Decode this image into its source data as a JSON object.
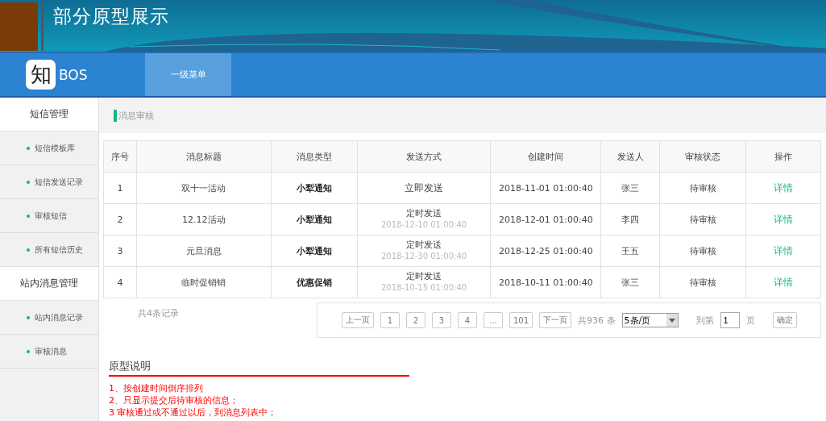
{
  "banner": {
    "title": "部分原型展示"
  },
  "nav": {
    "logo_mark": "知",
    "logo_text": "BOS",
    "menu": [
      {
        "label": "一级菜单",
        "selected": true
      }
    ]
  },
  "sidebar": {
    "groups": [
      {
        "title": "短信管理",
        "items": [
          {
            "label": "短信模板库"
          },
          {
            "label": "短信发送记录"
          },
          {
            "label": "审核短信"
          },
          {
            "label": "所有短信历史"
          }
        ]
      },
      {
        "title": "站内消息管理",
        "items": [
          {
            "label": "站内消息记录"
          },
          {
            "label": "审核消息"
          }
        ]
      }
    ]
  },
  "breadcrumb": "消息审核",
  "table": {
    "columns": [
      "序号",
      "消息标题",
      "消息类型",
      "发送方式",
      "创建时间",
      "发送人",
      "审核状态",
      "操作"
    ],
    "rows": [
      {
        "no": "1",
        "title": "双十一活动",
        "type": "小犁通知",
        "send": {
          "kind": "immediate",
          "method": "立即发送"
        },
        "created": "2018-11-01  01:00:40",
        "sender": "张三",
        "status": "待审核",
        "action": "详情"
      },
      {
        "no": "2",
        "title": "12.12活动",
        "type": "小犁通知",
        "send": {
          "kind": "scheduled",
          "method": "定时发送",
          "time": "2018-12-10  01:00:40"
        },
        "created": "2018-12-01  01:00:40",
        "sender": "李四",
        "status": "待审核",
        "action": "详情"
      },
      {
        "no": "3",
        "title": "元旦消息",
        "type": "小犁通知",
        "send": {
          "kind": "scheduled",
          "method": "定时发送",
          "time": "2018-12-30  01:00:40"
        },
        "created": "2018-12-25  01:00:40",
        "sender": "王五",
        "status": "待审核",
        "action": "详情"
      },
      {
        "no": "4",
        "title": "临时促销销",
        "type": "优惠促销",
        "send": {
          "kind": "scheduled",
          "method": "定时发送",
          "time": "2018-10-15  01:00:40"
        },
        "created": "2018-10-11  01:00:40",
        "sender": "张三",
        "status": "待审核",
        "action": "详情"
      }
    ]
  },
  "record_count": "共4条记录",
  "pagination": {
    "prev": "上一页",
    "pages": [
      "1",
      "2",
      "3",
      "4",
      "...",
      "101"
    ],
    "next": "下一页",
    "total": "共936 条",
    "page_size": "5条/页",
    "goto_label": "到第",
    "goto_value": "1",
    "goto_suffix": "页",
    "confirm": "确定"
  },
  "notes": {
    "title": "原型说明",
    "lines": [
      "1、按创建时间倒序排列",
      "2、只显示提交后待审核的信息；",
      "3 审核通过或不通过以后，到消息列表中；"
    ]
  }
}
